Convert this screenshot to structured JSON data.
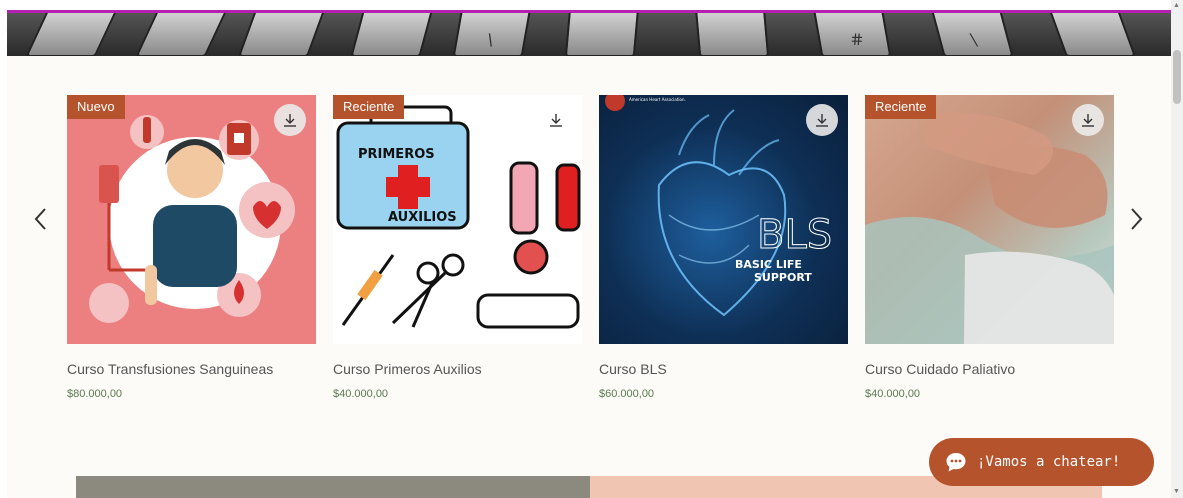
{
  "colors": {
    "accent": "#b5532c",
    "price": "#5b7a4f",
    "title": "#555555",
    "divider": "#b41fb4",
    "background": "#fcfbf8"
  },
  "hero": {
    "key_glyphs": [
      "\\",
      "#",
      "\\"
    ]
  },
  "carousel": {
    "prev_icon": "chevron-left-icon",
    "next_icon": "chevron-right-icon",
    "products": [
      {
        "badge": "Nuevo",
        "name": "Curso Transfusiones Sanguineas",
        "price": "$80.000,00",
        "image": "transfusion-illustration"
      },
      {
        "badge": "Reciente",
        "name": "Curso Primeros Auxilios",
        "price": "$40.000,00",
        "image": "first-aid-kit-illustration",
        "image_text_1": "PRIMEROS",
        "image_text_2": "AUXILIOS"
      },
      {
        "badge": "",
        "name": "Curso BLS",
        "price": "$60.000,00",
        "image": "bls-heart-photo",
        "image_text_1": "BLS",
        "image_text_2": "BASIC LIFE",
        "image_text_3": "SUPPORT",
        "image_logo": "American Heart Association."
      },
      {
        "badge": "Reciente",
        "name": "Curso Cuidado Paliativo",
        "price": "$40.000,00",
        "image": "palliative-hands-photo"
      }
    ]
  },
  "chat": {
    "label": "¡Vamos a chatear!",
    "icon": "chat-bubble-icon"
  },
  "scrollbar": {
    "up": "▲",
    "down": "▼"
  }
}
